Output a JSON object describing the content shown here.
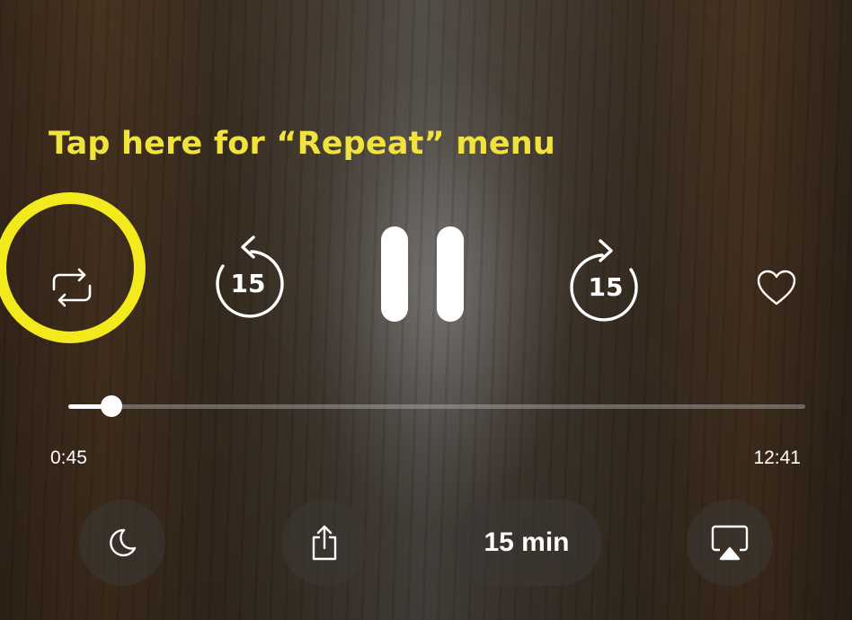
{
  "overlay": {
    "hint_text": "Tap here for “Repeat” menu",
    "hint_color": "#f1e33d",
    "ring_color": "#f2ea1c"
  },
  "controls": {
    "repeat_icon": "repeat-icon",
    "skip_back_seconds": "15",
    "play_state": "pause-icon",
    "skip_forward_seconds": "15",
    "favorite_icon": "heart-icon"
  },
  "progress": {
    "elapsed": "0:45",
    "duration": "12:41",
    "fraction": 0.059
  },
  "bottom_bar": {
    "sleep_icon": "moon-icon",
    "share_icon": "share-icon",
    "timer_label": "15 min",
    "airplay_icon": "airplay-icon"
  }
}
